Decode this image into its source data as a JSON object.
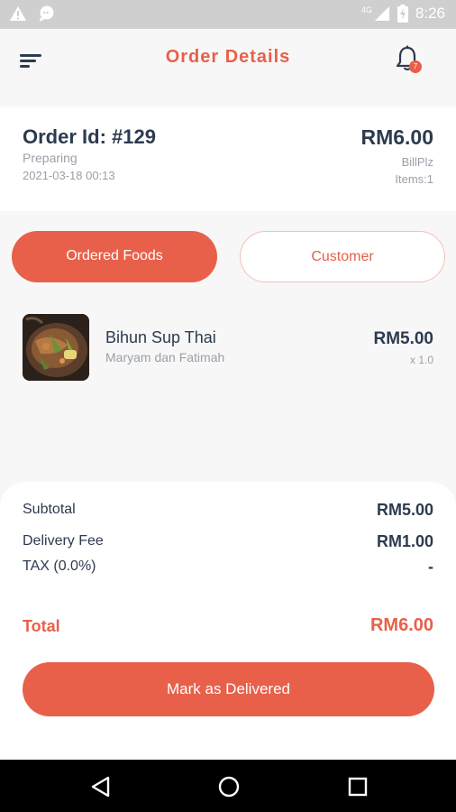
{
  "status_bar": {
    "time": "8:26",
    "network": "4G",
    "icons": [
      "warning-icon",
      "chat-icon",
      "signal-icon",
      "battery-icon"
    ]
  },
  "header": {
    "title": "Order Details",
    "notification_count": "7",
    "icons": [
      "menu-icon",
      "bell-icon"
    ]
  },
  "order": {
    "id_label": "Order Id: #129",
    "status": "Preparing",
    "datetime": "2021-03-18 00:13",
    "total": "RM6.00",
    "payment_method": "BillPlz",
    "items": "Items:1"
  },
  "tabs": [
    {
      "label": "Ordered Foods",
      "active": true
    },
    {
      "label": "Customer",
      "active": false
    }
  ],
  "foods": [
    {
      "name": "Bihun Sup Thai",
      "restaurant": "Maryam dan Fatimah",
      "price": "RM5.00",
      "quantity": "x 1.0"
    }
  ],
  "summary": {
    "subtotal_label": "Subtotal",
    "subtotal_value": "RM5.00",
    "delivery_label": "Delivery Fee",
    "delivery_value": "RM1.00",
    "tax_label": "TAX (0.0%)",
    "tax_value": "-",
    "total_label": "Total",
    "total_value": "RM6.00"
  },
  "action": {
    "deliver_label": "Mark as Delivered"
  },
  "nav": {
    "icons": [
      "back-icon",
      "home-icon",
      "recents-icon"
    ]
  },
  "colors": {
    "accent": "#e8604a",
    "text_dark": "#2d3a4f",
    "text_muted": "#9aa0a8"
  }
}
